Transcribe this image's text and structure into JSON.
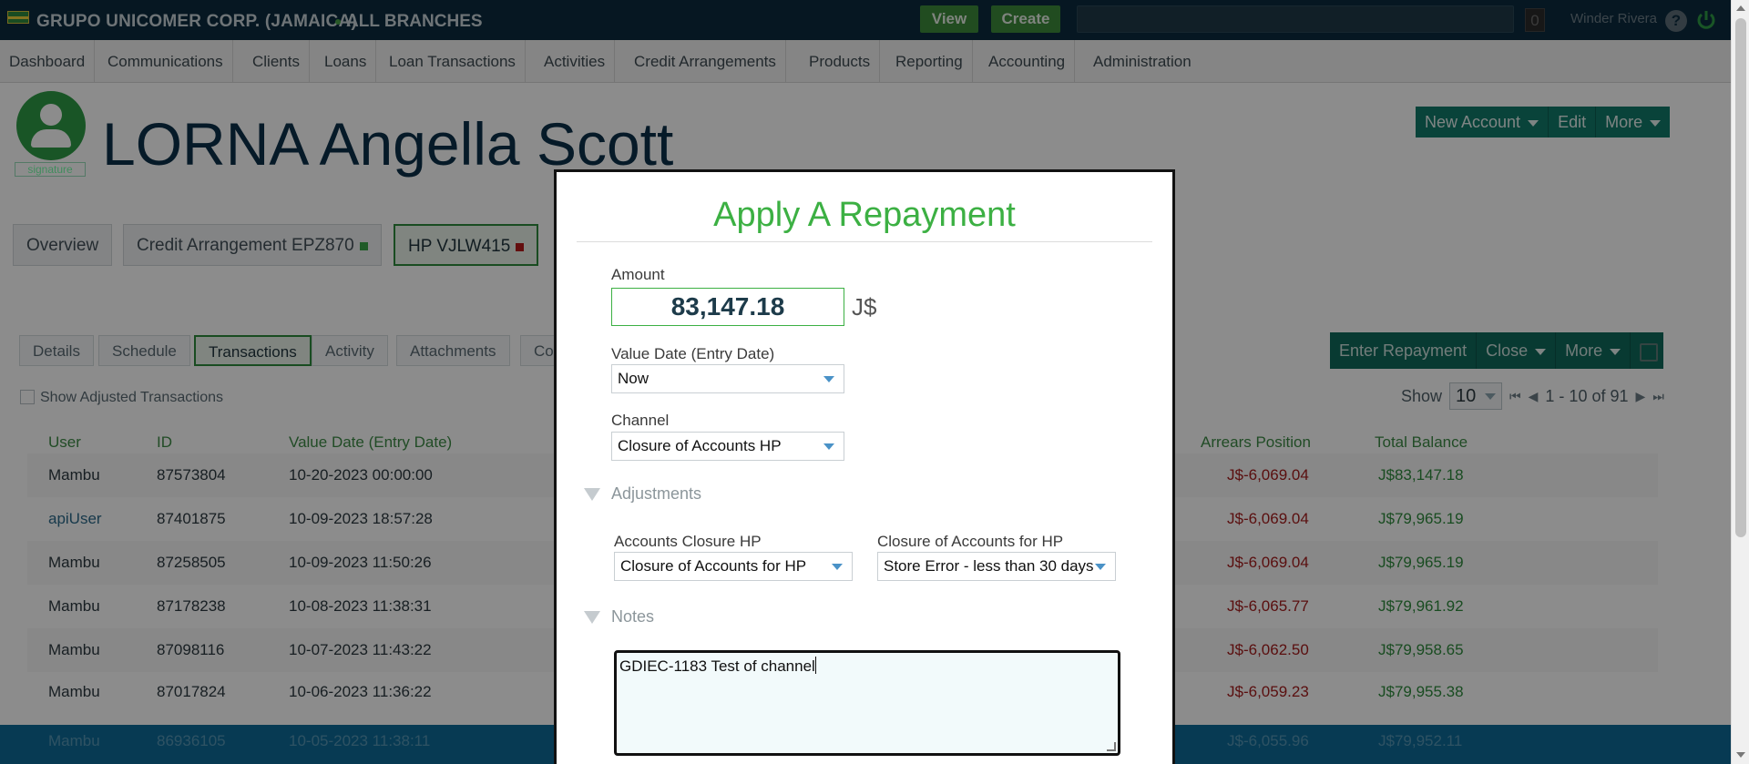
{
  "topbar": {
    "org_name": "GRUPO UNICOMER CORP. (JAMAICA)",
    "branch": "ALL BRANCHES",
    "view_label": "View",
    "create_label": "Create",
    "notification_count": "0",
    "user_name": "Winder Rivera",
    "help_glyph": "?"
  },
  "nav": {
    "items": [
      "Dashboard",
      "Communications",
      "Clients",
      "Loans",
      "Loan Transactions",
      "Activities",
      "Credit Arrangements",
      "Products",
      "Reporting",
      "Accounting",
      "Administration"
    ]
  },
  "client": {
    "name": "LORNA Angella Scott",
    "signature_label": "signature",
    "actions": [
      "New Account",
      "Edit",
      "More"
    ]
  },
  "account_tabs": [
    {
      "label": "Overview"
    },
    {
      "label": "Credit Arrangement EPZ870"
    },
    {
      "label": "HP VJLW415"
    }
  ],
  "loan_tabs": [
    "Details",
    "Schedule",
    "Transactions",
    "Activity",
    "Attachments",
    "Co"
  ],
  "show_adjusted_label": "Show Adjusted Transactions",
  "transaction_actions": [
    "Enter Repayment",
    "Close",
    "More"
  ],
  "pager": {
    "show_label": "Show",
    "page_size": "10",
    "range_text": "1 - 10 of 91"
  },
  "table": {
    "headers": {
      "user": "User",
      "id": "ID",
      "value_date": "Value Date (Entry Date)",
      "arrears": "Arrears Position",
      "total": "Total Balance"
    },
    "rows": [
      {
        "user": "Mambu",
        "id": "87573804",
        "date": "10-20-2023 00:00:00",
        "arrears": "J$-6,069.04",
        "total": "J$83,147.18"
      },
      {
        "user": "apiUser",
        "id": "87401875",
        "date": "10-09-2023 18:57:28",
        "arrears": "J$-6,069.04",
        "total": "J$79,965.19"
      },
      {
        "user": "Mambu",
        "id": "87258505",
        "date": "10-09-2023 11:50:26",
        "arrears": "J$-6,069.04",
        "total": "J$79,965.19"
      },
      {
        "user": "Mambu",
        "id": "87178238",
        "date": "10-08-2023 11:38:31",
        "arrears": "J$-6,065.77",
        "total": "J$79,961.92"
      },
      {
        "user": "Mambu",
        "id": "87098116",
        "date": "10-07-2023 11:43:22",
        "arrears": "J$-6,062.50",
        "total": "J$79,958.65"
      },
      {
        "user": "Mambu",
        "id": "87017824",
        "date": "10-06-2023 11:36:22",
        "arrears": "J$-6,059.23",
        "total": "J$79,955.38"
      },
      {
        "user": "Mambu",
        "id": "86936105",
        "date": "10-05-2023 11:38:11",
        "arrears": "J$-6,055.96",
        "total": "J$79,952.11"
      }
    ]
  },
  "modal": {
    "title": "Apply A Repayment",
    "amount_label": "Amount",
    "amount_value": "83,147.18",
    "currency": "J$",
    "value_date_label": "Value Date (Entry Date)",
    "value_date_value": "Now",
    "channel_label": "Channel",
    "channel_value": "Closure of Accounts HP",
    "adjustments_label": "Adjustments",
    "accounts_closure_label": "Accounts Closure HP",
    "accounts_closure_value": "Closure of Accounts for HP",
    "closure_for_hp_label": "Closure of Accounts for HP",
    "closure_for_hp_value": "Store Error - less than 30 days",
    "notes_label": "Notes",
    "notes_value": "GDIEC-1183 Test of channel"
  },
  "colors": {
    "topbar_bg": "#0b2b3e",
    "accent_green": "#3cb043",
    "action_teal": "#117a6b",
    "arrears_red": "#a51c1c"
  }
}
